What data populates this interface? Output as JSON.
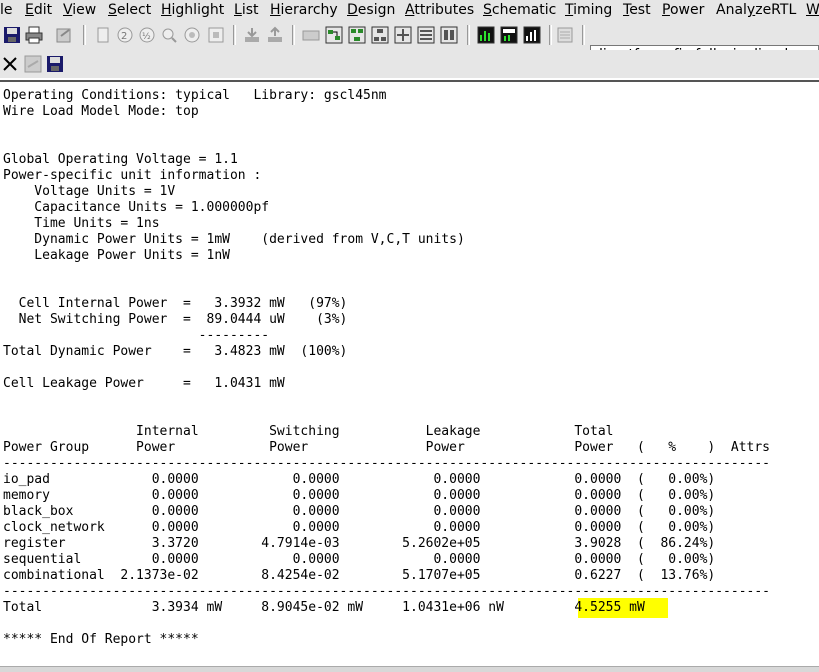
{
  "menu": [
    {
      "label": "le",
      "underline": ""
    },
    {
      "label": "Edit",
      "underline": "E"
    },
    {
      "label": "View",
      "underline": "V"
    },
    {
      "label": "Select",
      "underline": "S"
    },
    {
      "label": "Highlight",
      "underline": "H"
    },
    {
      "label": "List",
      "underline": "L"
    },
    {
      "label": "Hierarchy",
      "underline": "H"
    },
    {
      "label": "Design",
      "underline": "D"
    },
    {
      "label": "Attributes",
      "underline": "A"
    },
    {
      "label": "Schematic",
      "underline": "S"
    },
    {
      "label": "Timing",
      "underline": "T"
    },
    {
      "label": "Test",
      "underline": "T"
    },
    {
      "label": "Power",
      "underline": "P"
    },
    {
      "label": "AnalyzeRTL",
      "underline": "y"
    },
    {
      "label": "W",
      "underline": "W"
    }
  ],
  "toolbar": {
    "design_name": "directform_fir_full_pipelined"
  },
  "report": {
    "lines": [
      "Operating Conditions: typical   Library: gscl45nm",
      "Wire Load Model Mode: top",
      "",
      "",
      "Global Operating Voltage = 1.1",
      "Power-specific unit information :",
      "    Voltage Units = 1V",
      "    Capacitance Units = 1.000000pf",
      "    Time Units = 1ns",
      "    Dynamic Power Units = 1mW    (derived from V,C,T units)",
      "    Leakage Power Units = 1nW",
      "",
      "",
      "  Cell Internal Power  =   3.3932 mW   (97%)",
      "  Net Switching Power  =  89.0444 uW    (3%)",
      "                         ---------",
      "Total Dynamic Power    =   3.4823 mW  (100%)",
      "",
      "Cell Leakage Power     =   1.0431 mW",
      "",
      "",
      "                 Internal         Switching           Leakage            Total",
      "Power Group      Power            Power               Power              Power   (   %    )  Attrs",
      "--------------------------------------------------------------------------------------------------",
      "io_pad             0.0000            0.0000            0.0000            0.0000  (   0.00%)",
      "memory             0.0000            0.0000            0.0000            0.0000  (   0.00%)",
      "black_box          0.0000            0.0000            0.0000            0.0000  (   0.00%)",
      "clock_network      0.0000            0.0000            0.0000            0.0000  (   0.00%)",
      "register           3.3720        4.7914e-03        5.2602e+05            3.9028  (  86.24%)",
      "sequential         0.0000            0.0000            0.0000            0.0000  (   0.00%)",
      "combinational  2.1373e-02        8.4254e-02        5.1707e+05            0.6227  (  13.76%)",
      "--------------------------------------------------------------------------------------------------",
      "Total              3.3934 mW     8.9045e-02 mW     1.0431e+06 nW         4.5255 mW",
      "",
      "***** End Of Report *****"
    ],
    "highlighted_total": "4.5255 mW",
    "highlight_color": "#ffff00"
  }
}
